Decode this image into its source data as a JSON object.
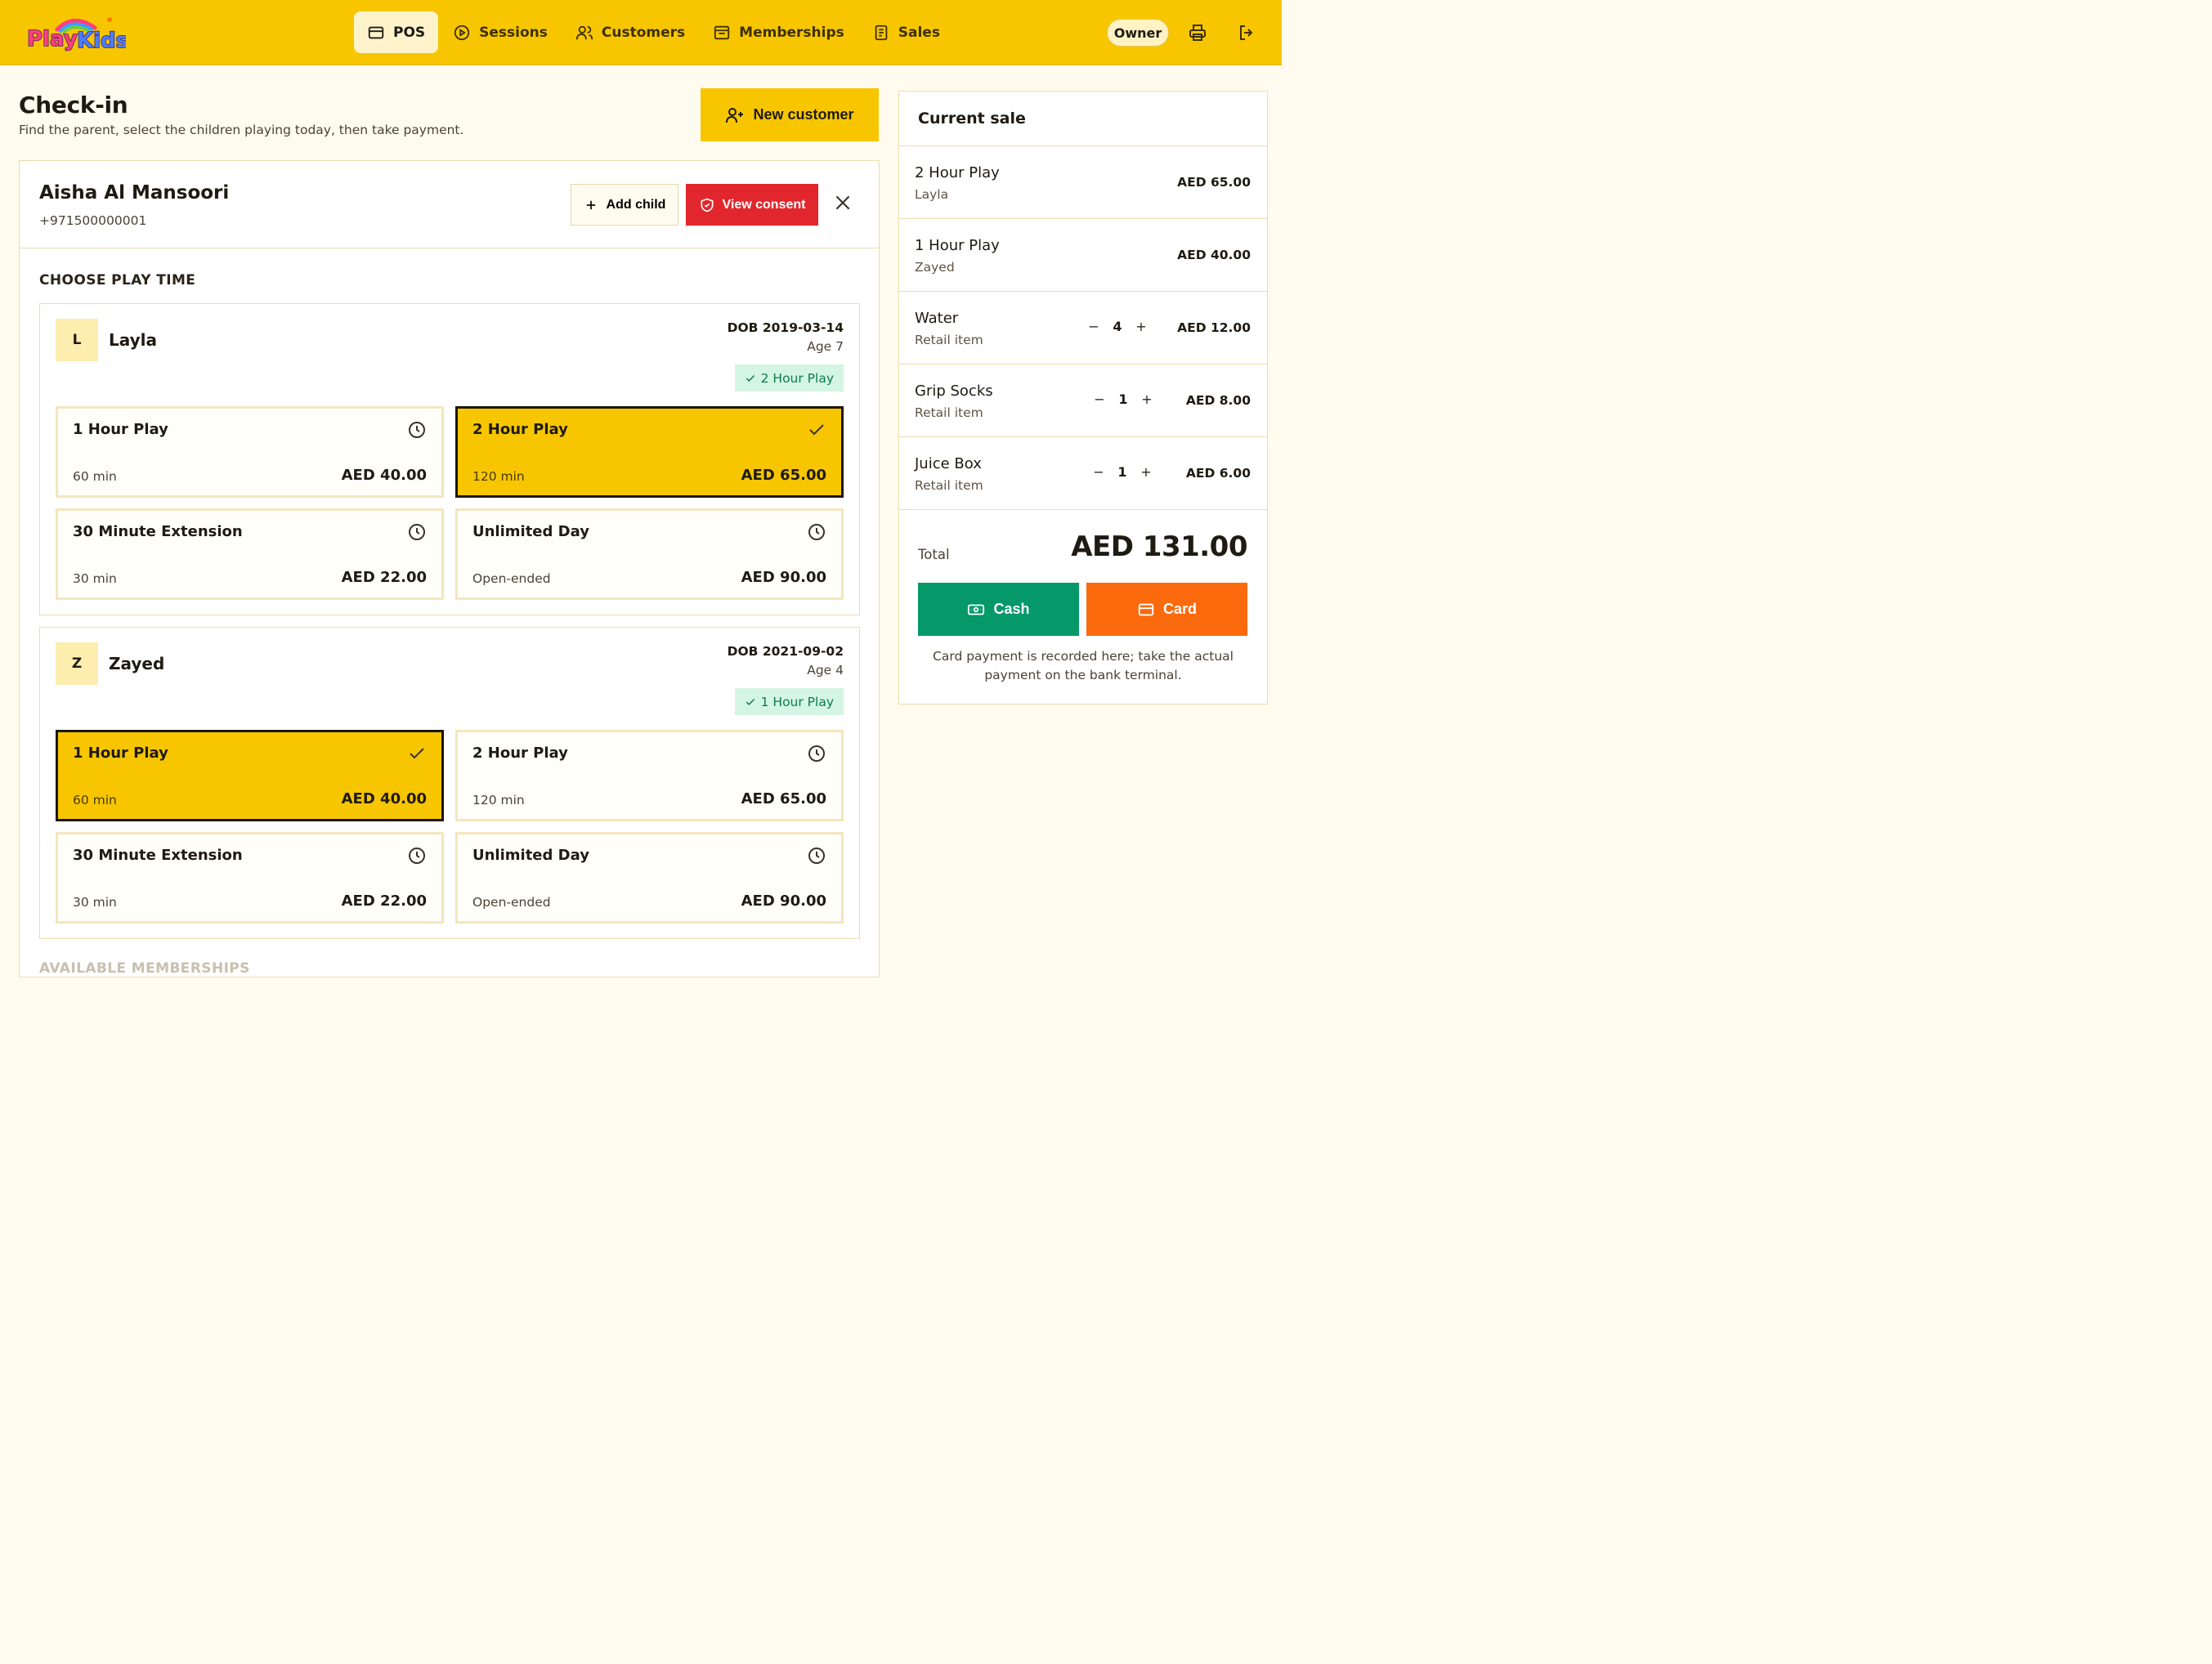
{
  "app": {
    "logo_text": "PlayKids"
  },
  "nav": [
    {
      "label": "POS",
      "icon": "card-icon",
      "active": true
    },
    {
      "label": "Sessions",
      "icon": "play-circle-icon"
    },
    {
      "label": "Customers",
      "icon": "users-icon"
    },
    {
      "label": "Memberships",
      "icon": "membership-icon"
    },
    {
      "label": "Sales",
      "icon": "receipt-icon"
    }
  ],
  "topbar": {
    "role": "Owner"
  },
  "header": {
    "title": "Check-in",
    "subtitle": "Find the parent, select the children playing today, then take payment.",
    "new_customer_label": "New customer"
  },
  "customer": {
    "name": "Aisha Al Mansoori",
    "phone": "+971500000001",
    "add_child_label": "Add child",
    "view_consent_label": "View consent"
  },
  "section": {
    "choose_play_time": "CHOOSE PLAY TIME",
    "next_section": "AVAILABLE MEMBERSHIPS"
  },
  "children": [
    {
      "initial": "L",
      "name": "Layla",
      "dob": "DOB 2019-03-14",
      "age": "Age 7",
      "selected_badge": "2 Hour Play",
      "options": [
        {
          "title": "1 Hour Play",
          "duration": "60 min",
          "price": "AED 40.00",
          "selected": false
        },
        {
          "title": "2 Hour Play",
          "duration": "120 min",
          "price": "AED 65.00",
          "selected": true
        },
        {
          "title": "30 Minute Extension",
          "duration": "30 min",
          "price": "AED 22.00",
          "selected": false
        },
        {
          "title": "Unlimited Day",
          "duration": "Open-ended",
          "price": "AED 90.00",
          "selected": false
        }
      ]
    },
    {
      "initial": "Z",
      "name": "Zayed",
      "dob": "DOB 2021-09-02",
      "age": "Age 4",
      "selected_badge": "1 Hour Play",
      "options": [
        {
          "title": "1 Hour Play",
          "duration": "60 min",
          "price": "AED 40.00",
          "selected": true
        },
        {
          "title": "2 Hour Play",
          "duration": "120 min",
          "price": "AED 65.00",
          "selected": false
        },
        {
          "title": "30 Minute Extension",
          "duration": "30 min",
          "price": "AED 22.00",
          "selected": false
        },
        {
          "title": "Unlimited Day",
          "duration": "Open-ended",
          "price": "AED 90.00",
          "selected": false
        }
      ]
    }
  ],
  "sale": {
    "title": "Current sale",
    "items": [
      {
        "name": "2 Hour Play",
        "sub": "Layla",
        "price": "AED 65.00"
      },
      {
        "name": "1 Hour Play",
        "sub": "Zayed",
        "price": "AED 40.00"
      },
      {
        "name": "Water",
        "sub": "Retail item",
        "qty": "4",
        "price": "AED 12.00"
      },
      {
        "name": "Grip Socks",
        "sub": "Retail item",
        "qty": "1",
        "price": "AED 8.00"
      },
      {
        "name": "Juice Box",
        "sub": "Retail item",
        "qty": "1",
        "price": "AED 6.00"
      }
    ],
    "qty_minus": "−",
    "qty_plus": "+",
    "total_label": "Total",
    "total_value": "AED 131.00",
    "cash_label": "Cash",
    "card_label": "Card",
    "note": "Card payment is recorded here; take the actual payment on the bank terminal."
  },
  "colors": {
    "brand_yellow": "#f7c600",
    "danger_red": "#e1262d",
    "cash_green": "#05996a",
    "card_orange": "#fb6a0d",
    "badge_green_bg": "#d4f5e3"
  }
}
